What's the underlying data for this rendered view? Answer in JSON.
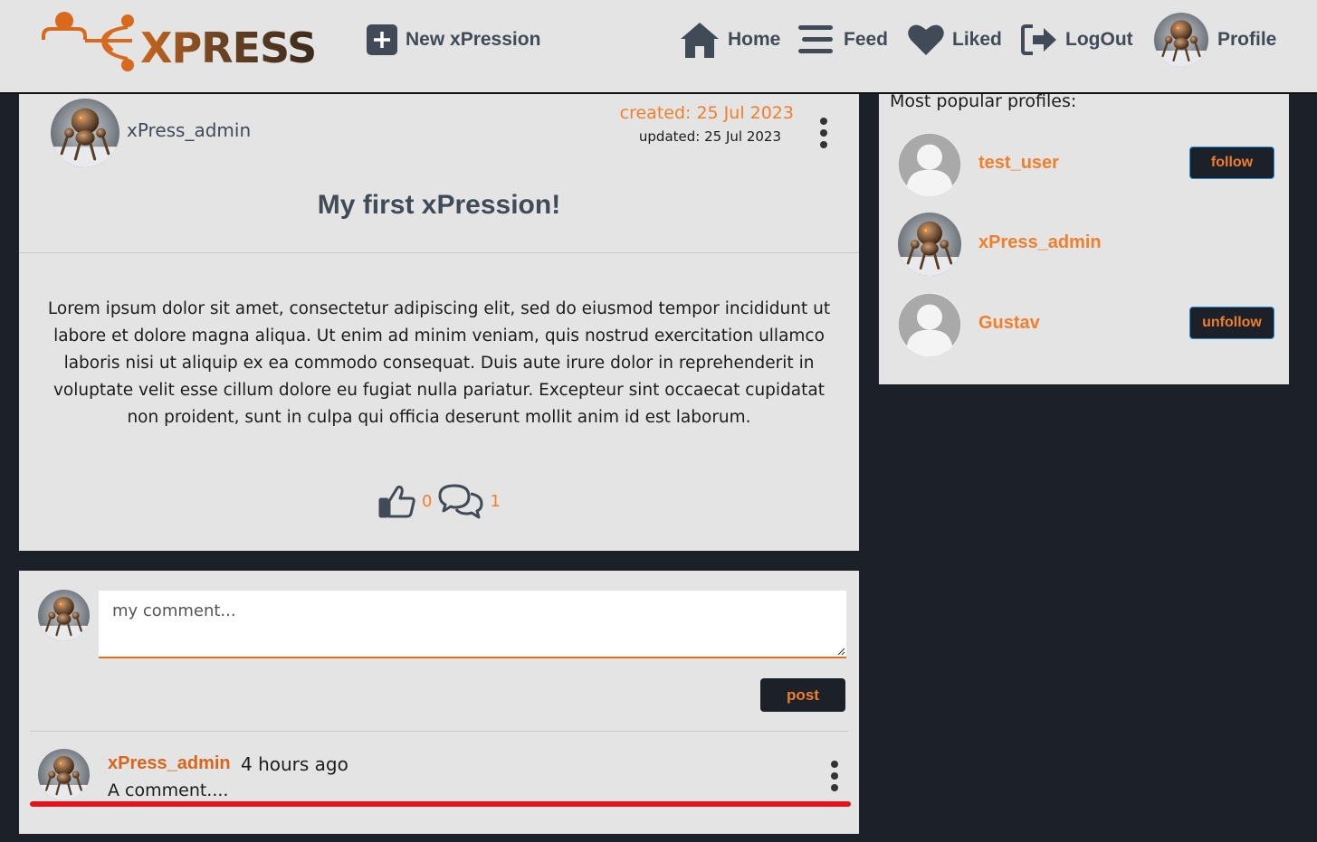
{
  "brand": {
    "logo_text": "XPRESS"
  },
  "nav": {
    "new_label": "New xPression",
    "home_label": "Home",
    "feed_label": "Feed",
    "liked_label": "Liked",
    "logout_label": "LogOut",
    "profile_label": "Profile"
  },
  "post": {
    "author": "xPress_admin",
    "created": "created: 25 Jul 2023",
    "updated": "updated: 25 Jul 2023",
    "title": "My first xPression!",
    "body": "Lorem ipsum dolor sit amet, consectetur adipiscing elit, sed do eiusmod tempor incididunt ut labore et dolore magna aliqua. Ut enim ad minim veniam, quis nostrud exercitation ullamco laboris nisi ut aliquip ex ea commodo consequat. Duis aute irure dolor in reprehenderit in voluptate velit esse cillum dolore eu fugiat nulla pariatur. Excepteur sint occaecat cupidatat non proident, sunt in culpa qui officia deserunt mollit anim id est laborum.",
    "likes": "0",
    "comments": "1"
  },
  "comment_form": {
    "placeholder": "my comment...",
    "value": "",
    "post_label": "post"
  },
  "comments": [
    {
      "user": "xPress_admin",
      "time": "4 hours ago",
      "text": "A comment...."
    }
  ],
  "sidebar": {
    "title": "Most popular profiles:",
    "profiles": [
      {
        "name": "test_user",
        "button": "follow",
        "avatar": "default-avatar-icon"
      },
      {
        "name": "xPress_admin",
        "button": "",
        "avatar": "robot-avatar"
      },
      {
        "name": "Gustav",
        "button": "unfollow",
        "avatar": "default-avatar-icon"
      }
    ]
  },
  "colors": {
    "accent": "#f07f2d",
    "dark": "#1c2028",
    "panel": "#e3e4e3",
    "nav_text": "#414b57",
    "highlight_line": "#e2141d"
  }
}
